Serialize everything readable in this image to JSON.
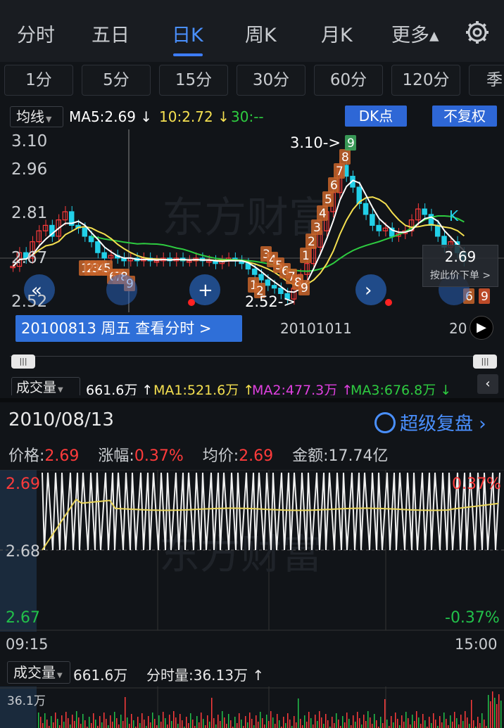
{
  "tabs": [
    "分时",
    "五日",
    "日K",
    "周K",
    "月K",
    "更多▴"
  ],
  "periods": [
    "1分",
    "5分",
    "15分",
    "30分",
    "60分",
    "120分",
    "季"
  ],
  "ma_bar": {
    "toggle": "均线",
    "ma5": "MA5:2.69 ↓",
    "ma10": "10:2.72 ↓",
    "ma30": "30:--",
    "dk_button": "DK点",
    "adjust_button": "不复权",
    "colors": {
      "ma5": "#ffffff",
      "ma10": "#f5e050",
      "ma30": "#2ecc40"
    }
  },
  "kline": {
    "y_labels": [
      "3.10",
      "2.96",
      "2.81",
      "2.67",
      "2.52"
    ],
    "high_marker": "3.10->",
    "low_marker": "2.52->",
    "crosshair_value": "2.69",
    "press_order": "按此价下单 >",
    "date_tip": "20100813 周五 查看分时 >",
    "date_axis": [
      "20101011",
      "20"
    ],
    "signals_left": [
      "1",
      "2",
      "3",
      "4",
      "5",
      "6",
      "7",
      "8",
      "9"
    ],
    "signals_low": [
      "1",
      "2",
      "3",
      "4",
      "5",
      "6",
      "7",
      "8",
      "9"
    ],
    "signals_up": [
      "1",
      "2",
      "3",
      "4",
      "5",
      "6",
      "7",
      "8",
      "9"
    ],
    "signals_right": [
      "6",
      "9"
    ],
    "signal_k": "K",
    "watermark": "东方财富"
  },
  "volume_bar": {
    "toggle": "成交量",
    "value": "661.6万 ↑",
    "ma1": "MA1:521.6万 ↑",
    "ma2": "MA2:477.3万 ↑",
    "ma3": "MA3:676.8万 ↓",
    "colors": {
      "ma1": "#f5e050",
      "ma2": "#e040e0",
      "ma3": "#2ecc40"
    }
  },
  "intraday": {
    "date": "2010/08/13",
    "super_review": "超级复盘",
    "price_label": "价格:",
    "price": "2.69",
    "change_label": "涨幅:",
    "change": "0.37%",
    "avg_label": "均价:",
    "avg": "2.69",
    "amount_label": "金额:",
    "amount": "17.74亿",
    "y_left": [
      "2.69",
      "2.68",
      "2.67"
    ],
    "y_right": [
      "0.37%",
      "-0.37%"
    ],
    "time_start": "09:15",
    "time_end": "15:00",
    "watermark": "东方财富"
  },
  "intraday_volume": {
    "toggle": "成交量",
    "value": "661.6万",
    "period_volume": "分时量:36.13万 ↑",
    "max_label": "36.1万"
  }
}
